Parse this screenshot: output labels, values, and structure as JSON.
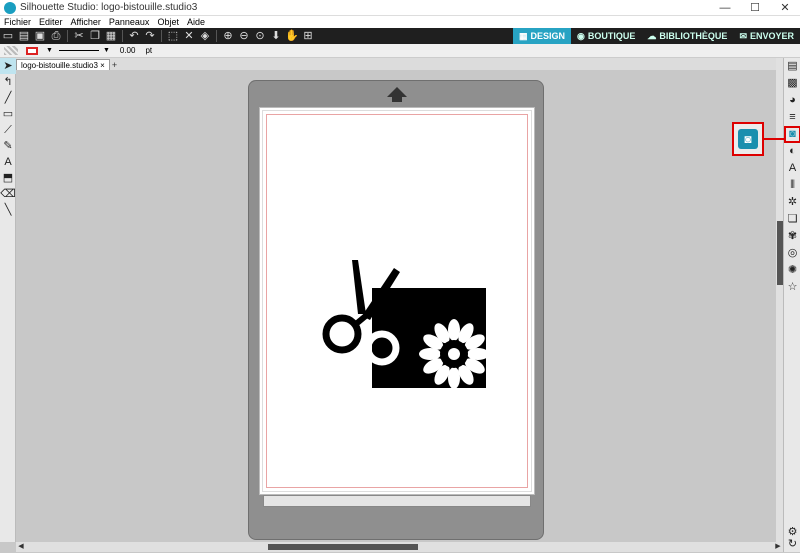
{
  "window": {
    "title": "Silhouette Studio: logo-bistouille.studio3",
    "minimize": "—",
    "maximize": "☐",
    "close": "✕"
  },
  "menu": [
    "Fichier",
    "Editer",
    "Afficher",
    "Panneaux",
    "Objet",
    "Aide"
  ],
  "toolbar": {
    "icons": [
      "new-icon",
      "open-icon",
      "save-icon",
      "print-icon",
      "cut-icon",
      "copy-icon",
      "paste-icon",
      "undo-icon",
      "redo-icon",
      "select-icon",
      "deselect-icon",
      "group-icon",
      "zoom-in-icon",
      "zoom-out-icon",
      "zoom-fit-icon",
      "move-down-icon",
      "pan-icon",
      "fit-page-icon"
    ]
  },
  "tabs": [
    {
      "label": "DESIGN",
      "active": true
    },
    {
      "label": "BOUTIQUE",
      "active": false
    },
    {
      "label": "BIBLIOTHÈQUE",
      "active": false
    },
    {
      "label": "ENVOYER",
      "active": false
    }
  ],
  "properties": {
    "line_width": "0.00",
    "unit": "pt"
  },
  "document": {
    "tab_label": "logo-bistouille.studio3",
    "tab_close": "×",
    "add_tab": "+"
  },
  "colors": {
    "accent": "#27a3c3",
    "highlight": "#dd0000",
    "logo": "#000000"
  }
}
